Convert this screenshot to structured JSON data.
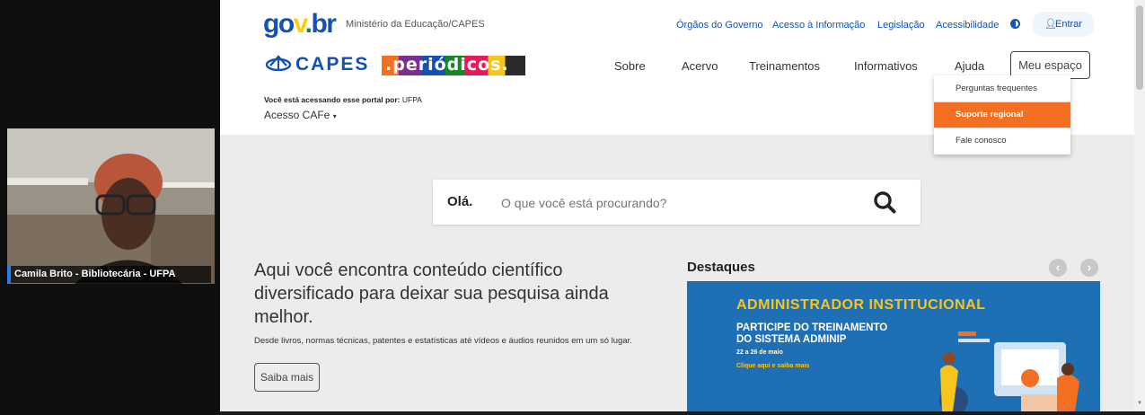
{
  "video": {
    "participant_name": "Camila Brito - Bibliotecária - UFPA"
  },
  "header": {
    "govbr_logo": "gov.br",
    "ministry": "Ministério da Educação/CAPES",
    "links": [
      "Órgãos do Governo",
      "Acesso à Informação",
      "Legislação",
      "Acessibilidade"
    ],
    "contrast_icon": "half-circle-icon",
    "login_label": "Entrar",
    "capes_logo": "CAPES",
    "periodicos_logo": ".periódicos."
  },
  "nav": {
    "items": [
      "Sobre",
      "Acervo",
      "Treinamentos",
      "Informativos",
      "Ajuda"
    ],
    "my_space": "Meu espaço"
  },
  "access": {
    "label": "Você está acessando esse portal por:",
    "institution": "UFPA",
    "cafe": "Acesso CAFe"
  },
  "help_dropdown": {
    "items": [
      "Perguntas frequentes",
      "Suporte regional",
      "Fale conosco"
    ],
    "highlighted_index": 1,
    "highlight_color": "#f36f21"
  },
  "search": {
    "greeting": "Olá.",
    "placeholder": "O que você está procurando?"
  },
  "intro": {
    "heading": "Aqui você encontra conteúdo científico diversificado para deixar sua pesquisa ainda melhor.",
    "description": "Desde livros, normas técnicas, patentes e estatísticas até vídeos e áudios reunidos em um só lugar.",
    "cta": "Saiba mais"
  },
  "highlights": {
    "title": "Destaques",
    "banner": {
      "headline": "ADMINISTRADOR INSTITUCIONAL",
      "subtitle_line1": "PARTICIPE DO TREINAMENTO",
      "subtitle_line2": "DO SISTEMA ADMINIP",
      "dates": "22 a 26 de maio",
      "link": "Clique aqui e saiba mais",
      "headline_color": "#f7c51b",
      "background_color": "#1f6fb5"
    }
  },
  "colors": {
    "govbr_blue": "#1351b4",
    "gov_yellow": "#ffcd07",
    "gov_green": "#168821"
  }
}
